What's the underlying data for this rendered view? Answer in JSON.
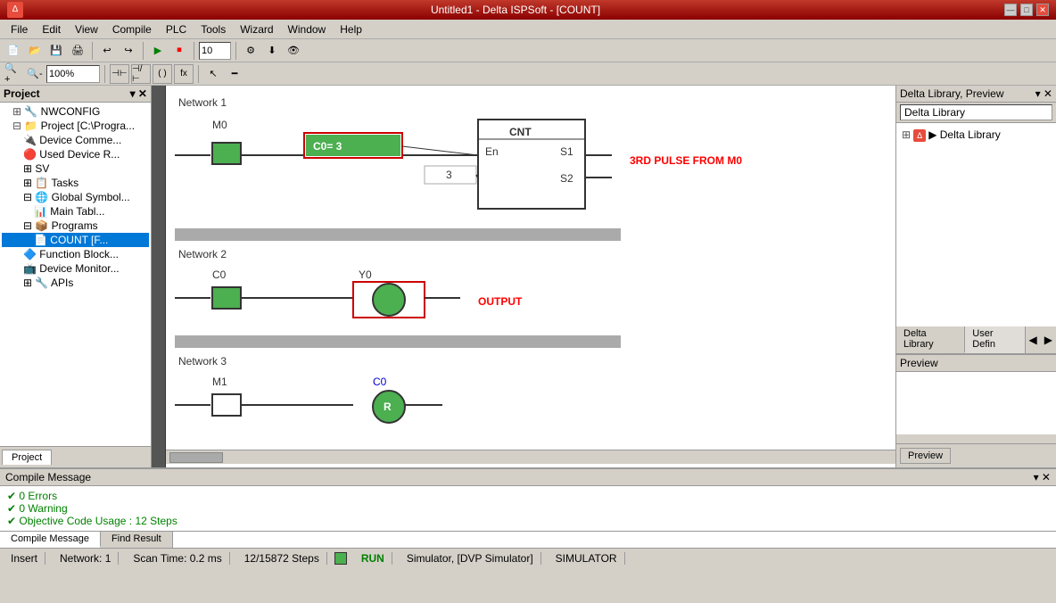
{
  "titlebar": {
    "title": "Untitled1 - Delta ISPSoft - [COUNT]",
    "btn_min": "—",
    "btn_max": "□",
    "btn_close": "✕"
  },
  "menu": {
    "items": [
      "File",
      "Edit",
      "View",
      "Compile",
      "PLC",
      "Tools",
      "Wizard",
      "Window",
      "Help"
    ]
  },
  "toolbar1": {
    "zoom_value": "100%",
    "speed_value": "10"
  },
  "project": {
    "header": "Project",
    "tree": [
      {
        "label": "NWCONFIG",
        "indent": 1,
        "icon": "cfg"
      },
      {
        "label": "Project [C:\\Program...",
        "indent": 1,
        "icon": "proj"
      },
      {
        "label": "Device Comme...",
        "indent": 2,
        "icon": "dev"
      },
      {
        "label": "Used Device R...",
        "indent": 2,
        "icon": "used"
      },
      {
        "label": "SV",
        "indent": 2,
        "icon": "sv"
      },
      {
        "label": "Tasks",
        "indent": 2,
        "icon": "tasks"
      },
      {
        "label": "Global Symbol...",
        "indent": 2,
        "icon": "global"
      },
      {
        "label": "Main Tabl...",
        "indent": 3,
        "icon": "main"
      },
      {
        "label": "Programs",
        "indent": 2,
        "icon": "prog"
      },
      {
        "label": "COUNT [F...",
        "indent": 3,
        "icon": "count",
        "selected": true
      },
      {
        "label": "Function Block...",
        "indent": 2,
        "icon": "fb"
      },
      {
        "label": "Device Monitor...",
        "indent": 2,
        "icon": "dm"
      },
      {
        "label": "APIs",
        "indent": 2,
        "icon": "api"
      }
    ]
  },
  "networks": [
    {
      "label": "Network 1",
      "elements": "cnt_block"
    },
    {
      "label": "Network 2",
      "elements": "output"
    },
    {
      "label": "Network 3",
      "elements": "reset"
    }
  ],
  "network1": {
    "contact_label": "M0",
    "block_title": "CNT",
    "block_en": "En",
    "block_s1": "S1",
    "block_s2": "S2",
    "counter_label": "C0= 3",
    "s2_value": "3",
    "annotation": "3RD PULSE FROM M0"
  },
  "network2": {
    "contact_label": "C0",
    "coil_label": "Y0",
    "annotation": "OUTPUT"
  },
  "network3": {
    "contact_label": "M1",
    "coil_label": "C0",
    "coil_symbol": "R"
  },
  "right_panel": {
    "header": "Delta Library, Preview",
    "lib_title": "Delta Library",
    "lib_tabs": [
      "Delta Library",
      "User Defin"
    ],
    "lib_item": "▶ Delta Library",
    "preview_label": "Preview",
    "preview_btn": "Preview"
  },
  "compile": {
    "header": "Compile Message",
    "messages": [
      "✔  0 Errors",
      "✔  0 Warning",
      "✔  Objective Code Usage : 12 Steps"
    ],
    "tabs": [
      "Compile Message",
      "Find Result"
    ]
  },
  "statusbar": {
    "mode": "Insert",
    "network": "Network: 1",
    "scan_time": "Scan Time: 0.2 ms",
    "steps": "12/15872 Steps",
    "run_label": "RUN",
    "simulator": "Simulator, [DVP Simulator]",
    "sim_label": "SIMULATOR"
  }
}
